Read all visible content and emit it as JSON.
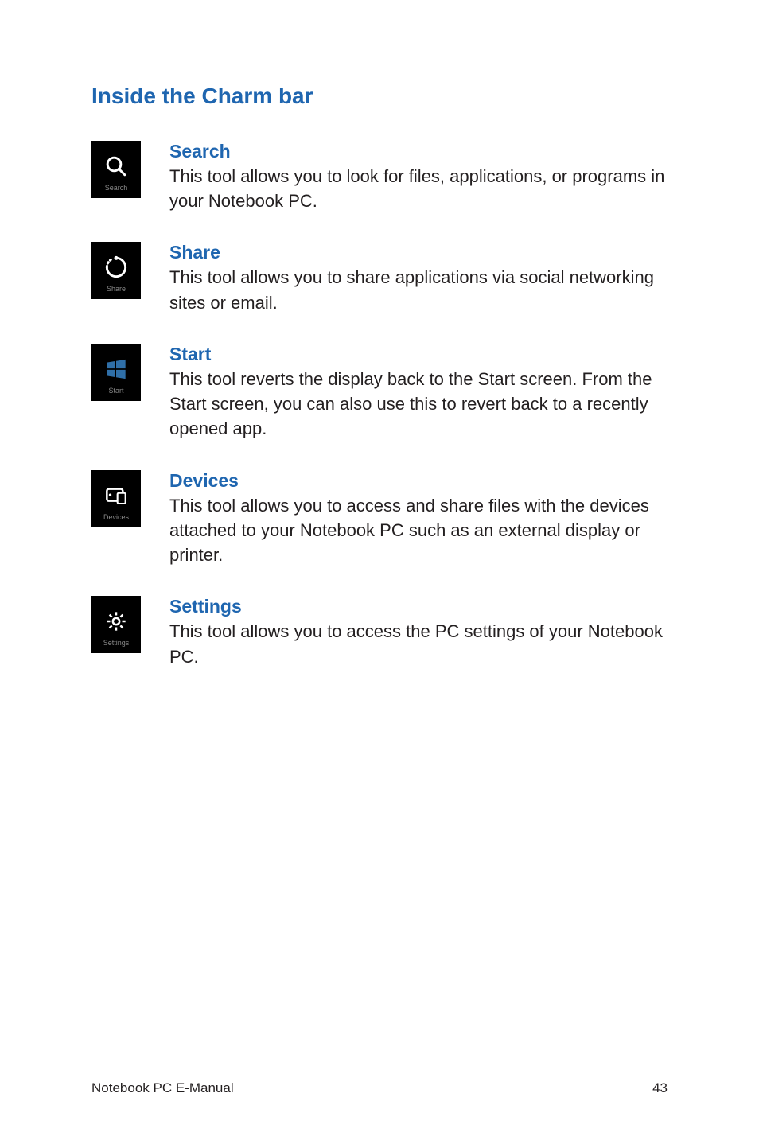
{
  "heading": "Inside the Charm bar",
  "items": [
    {
      "icon_label": "Search",
      "title": "Search",
      "description": "This tool allows you to look for files, applications, or programs in your Notebook PC."
    },
    {
      "icon_label": "Share",
      "title": "Share",
      "description": "This tool allows you to share applications via social networking sites or email."
    },
    {
      "icon_label": "Start",
      "title": "Start",
      "description": "This tool reverts the display back to the Start screen. From the Start screen, you can also use this to revert back to a recently opened app."
    },
    {
      "icon_label": "Devices",
      "title": "Devices",
      "description": "This tool allows you to access and share files with the devices attached to your Notebook PC such as an external display or printer."
    },
    {
      "icon_label": "Settings",
      "title": "Settings",
      "description": "This tool allows you to access the PC settings of your Notebook PC."
    }
  ],
  "footer": {
    "title": "Notebook PC E-Manual",
    "page": "43"
  }
}
